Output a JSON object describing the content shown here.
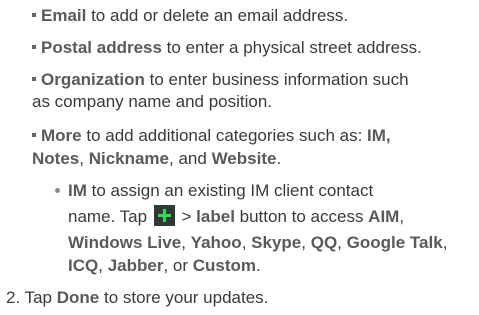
{
  "items": [
    {
      "bold": "Email",
      "text": " to add or delete an email address."
    },
    {
      "bold": "Postal address",
      "text": " to enter a physical street address."
    },
    {
      "bold": "Organization",
      "text1": " to enter business information such",
      "text2": "as company name and position."
    },
    {
      "bold": "More",
      "text1": " to add additional categories such as: ",
      "b_im": "IM,",
      "b_notes": "Notes",
      "comma1": ", ",
      "b_nick": "Nickname",
      "and": ", and ",
      "b_web": "Website",
      "period": "."
    }
  ],
  "sub": {
    "b_im": "IM",
    "l1": " to assign an existing IM client contact",
    "l2a": "name. Tap ",
    "l2b": " > ",
    "b_label": "label",
    "l2c": " button to access ",
    "b_aim": "AIM",
    "comma": ",",
    "b_winlive": "Windows Live",
    "b_yahoo": "Yahoo",
    "b_skype": "Skype",
    "b_qq": "QQ",
    "b_gtalk": "Google Talk",
    "b_icq": "ICQ",
    "b_jabber": "Jabber",
    "or": ", or ",
    "b_custom": "Custom",
    "end": "."
  },
  "step": {
    "num": "2.",
    "pre": " Tap ",
    "bold": "Done",
    "post": " to store your updates."
  },
  "colors": {
    "plus_bg": "#2f3a34",
    "plus_fg": "#36d65a"
  }
}
